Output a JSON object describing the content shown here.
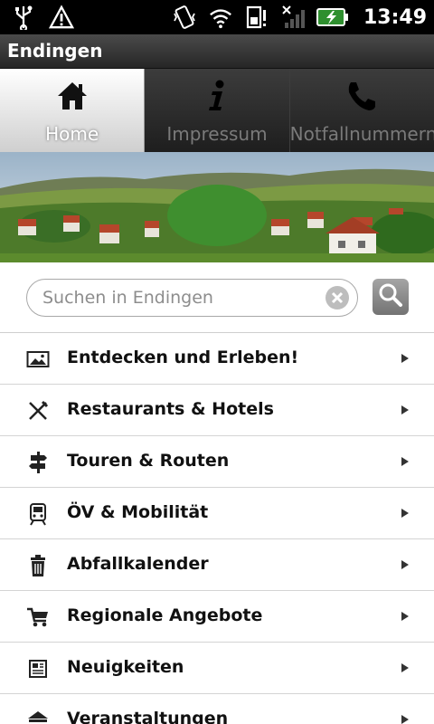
{
  "status_bar": {
    "time": "13:49",
    "left_icons": [
      "usb-icon",
      "warning-icon"
    ],
    "right_icons": [
      "vibrate-icon",
      "wifi-icon",
      "sd-card-icon",
      "no-signal-icon",
      "battery-charging-icon"
    ]
  },
  "app": {
    "title": "Endingen"
  },
  "tabs": [
    {
      "label": "Home",
      "icon": "home-icon",
      "active": true
    },
    {
      "label": "Impressum",
      "icon": "info-icon",
      "active": false
    },
    {
      "label": "Notfallnummern",
      "icon": "phone-icon",
      "active": false
    }
  ],
  "search": {
    "placeholder": "Suchen in Endingen"
  },
  "menu": {
    "items": [
      {
        "label": "Entdecken und Erleben!",
        "icon": "picture-icon"
      },
      {
        "label": "Restaurants & Hotels",
        "icon": "fork-knife-icon"
      },
      {
        "label": "Touren & Routen",
        "icon": "signpost-icon"
      },
      {
        "label": "ÖV & Mobilität",
        "icon": "train-icon"
      },
      {
        "label": "Abfallkalender",
        "icon": "trash-icon"
      },
      {
        "label": "Regionale Angebote",
        "icon": "cart-icon"
      },
      {
        "label": "Neuigkeiten",
        "icon": "newspaper-icon"
      },
      {
        "label": "Veranstaltungen",
        "icon": "event-icon"
      }
    ]
  }
}
